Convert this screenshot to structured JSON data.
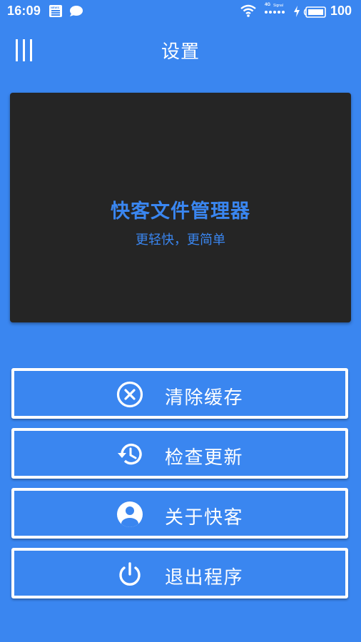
{
  "status_bar": {
    "time": "16:09",
    "news_icon_label": "NEWS",
    "signal_type": "4G",
    "signal_label": "Signal",
    "battery_level": "100",
    "icons": [
      "news-icon",
      "chat-icon",
      "wifi-icon",
      "signal-icon",
      "charging-icon",
      "battery-icon"
    ]
  },
  "app_bar": {
    "menu_icon": "menu-icon",
    "title": "设置"
  },
  "banner": {
    "title": "快客文件管理器",
    "subtitle": "更轻快，更简单",
    "background_color": "#252525",
    "text_color": "#3a86f0"
  },
  "actions": [
    {
      "label": "清除缓存",
      "icon": "clear-circle-icon"
    },
    {
      "label": "检查更新",
      "icon": "history-icon"
    },
    {
      "label": "关于快客",
      "icon": "account-circle-icon"
    },
    {
      "label": "退出程序",
      "icon": "power-icon"
    }
  ],
  "colors": {
    "background": "#3a86f0",
    "button_border": "#ffffff",
    "text": "#ffffff"
  }
}
